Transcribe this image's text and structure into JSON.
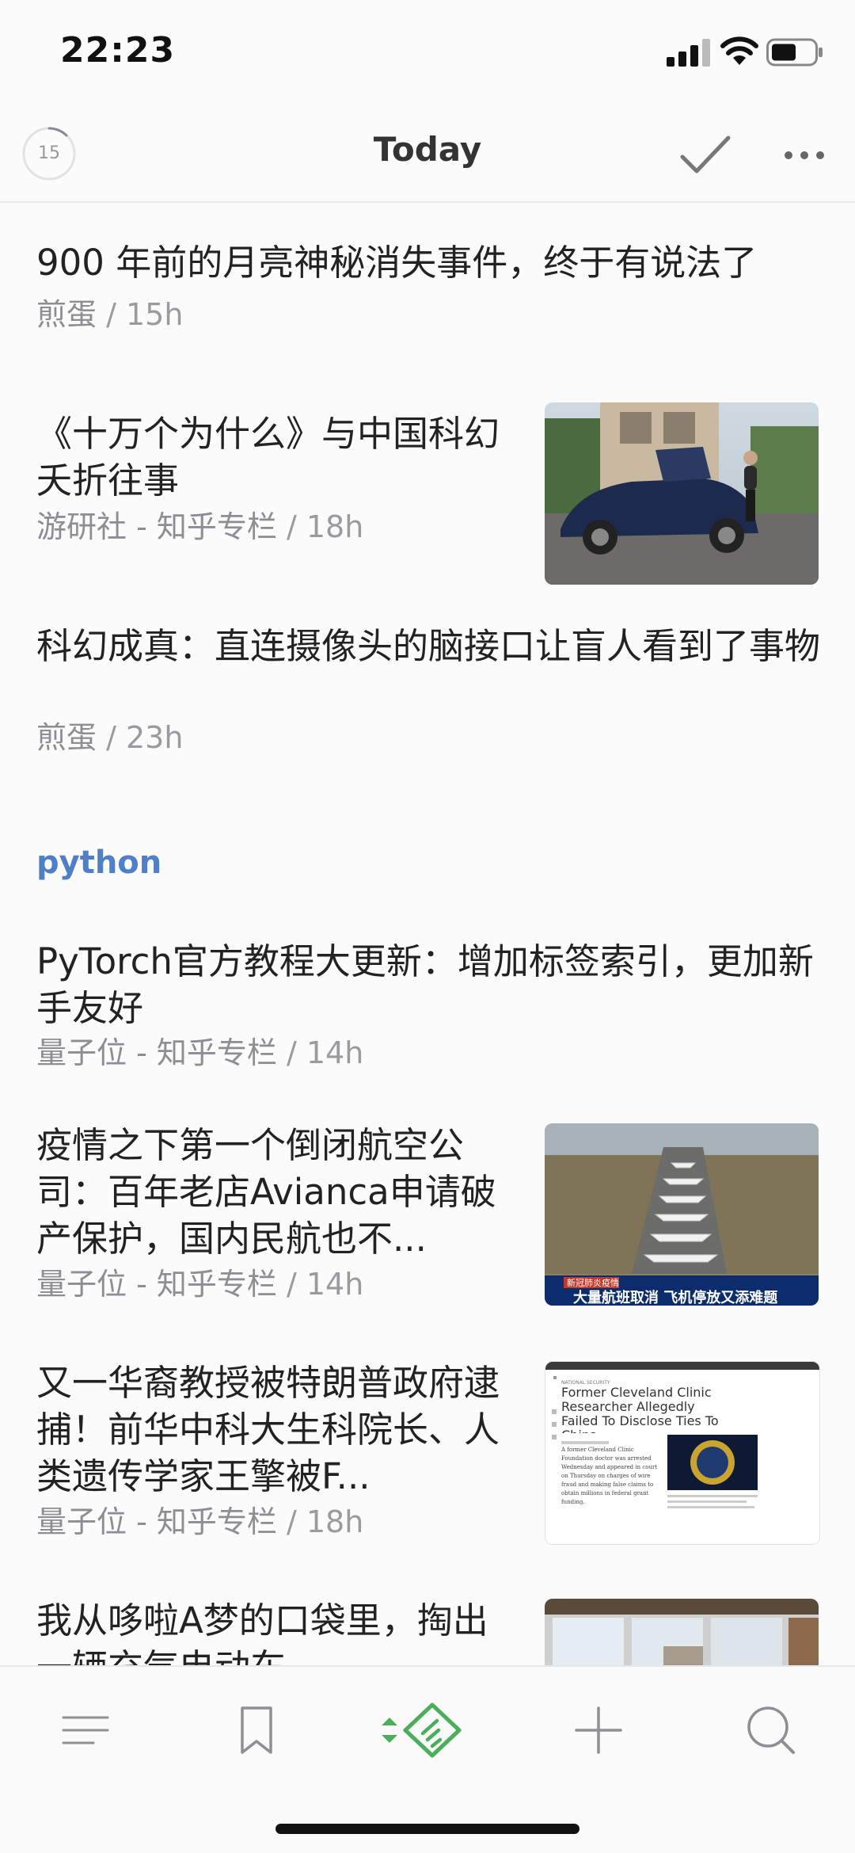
{
  "status_bar": {
    "time": "22:23"
  },
  "header": {
    "unread_count": "15",
    "title": "Today"
  },
  "colors": {
    "accent_green": "#4cae5a",
    "section_blue": "#4f7fc7",
    "meta_gray": "#9a9a9f"
  },
  "icons": {
    "unread": "circular-progress-icon",
    "mark_read": "checkmark-icon",
    "more": "more-dots-icon",
    "tabs": [
      "menu-lines-icon",
      "bookmark-icon",
      "feedly-logo-icon",
      "plus-icon",
      "search-icon"
    ]
  },
  "feed": {
    "items": [
      {
        "title": "900 年前的月亮神秘消失事件，终于有说法了",
        "source": "煎蛋",
        "time": "15h"
      },
      {
        "title": "《十万个为什么》与中国科幻夭折往事",
        "source": "游研社 - 知乎专栏",
        "time": "18h",
        "thumbnail": "electric-car-photo"
      },
      {
        "title": "科幻成真：直连摄像头的脑接口让盲人看到了事物",
        "source": "煎蛋",
        "time": "23h"
      }
    ],
    "section": {
      "label": "python"
    },
    "section_items": [
      {
        "title": "PyTorch官方教程大更新：增加标签索引，更加新手友好",
        "source": "量子位 - 知乎专栏",
        "time": "14h"
      },
      {
        "title": "疫情之下第一个倒闭航空公司：百年老店Avianca申请破产保护，国内民航也不...",
        "source": "量子位 - 知乎专栏",
        "time": "14h",
        "thumbnail": "parked-airplanes-photo",
        "thumbnail_caption_small": "新冠肺炎疫情",
        "thumbnail_caption": "大量航班取消 飞机停放又添难题"
      },
      {
        "title": "又一华裔教授被特朗普政府逮捕！前华中科大生科院长、人类遗传学家王擎被F...",
        "source": "量子位 - 知乎专栏",
        "time": "18h",
        "thumbnail": "news-article-screenshot",
        "thumbnail_kicker": "NATIONAL SECURITY",
        "thumbnail_headline": "Former Cleveland Clinic Researcher Allegedly Failed To Disclose Ties To China",
        "thumbnail_body": "A former Cleveland Clinic Foundation doctor was arrested Wednesday and appeared in court on Thursday on charges of wire fraud and making false claims to obtain millions in federal grant funding."
      },
      {
        "title": "我从哆啦A梦的口袋里，掏出一辆充气电动车",
        "source": "",
        "time": "",
        "thumbnail": "room-window-photo"
      }
    ]
  },
  "tab_bar": {
    "tabs": [
      {
        "name": "feeds-menu",
        "active": false
      },
      {
        "name": "saved",
        "active": false
      },
      {
        "name": "today",
        "active": true
      },
      {
        "name": "add",
        "active": false
      },
      {
        "name": "search",
        "active": false
      }
    ]
  }
}
